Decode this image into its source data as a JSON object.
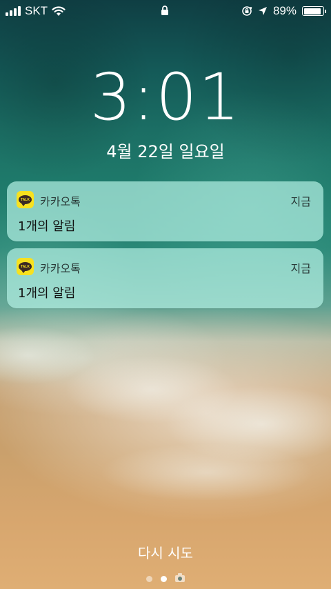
{
  "status_bar": {
    "carrier": "SKT",
    "battery_percent": "89%",
    "battery_level": 0.89,
    "icons": [
      "signal-icon",
      "wifi-icon",
      "lock-icon",
      "rotation-lock-icon",
      "location-arrow-icon",
      "battery-icon"
    ]
  },
  "lock_screen": {
    "time": "3:01",
    "date": "4월 22일 일요일"
  },
  "notifications": [
    {
      "app_name": "카카오톡",
      "app_icon_label": "TALK",
      "time": "지금",
      "body": "1개의 알림"
    },
    {
      "app_name": "카카오톡",
      "app_icon_label": "TALK",
      "time": "지금",
      "body": "1개의 알림"
    }
  ],
  "bottom": {
    "retry_label": "다시 시도",
    "page_count": 2,
    "active_page": 2
  },
  "colors": {
    "kakao_yellow": "#f7e11f",
    "notification_bg": "#b2eee2"
  }
}
